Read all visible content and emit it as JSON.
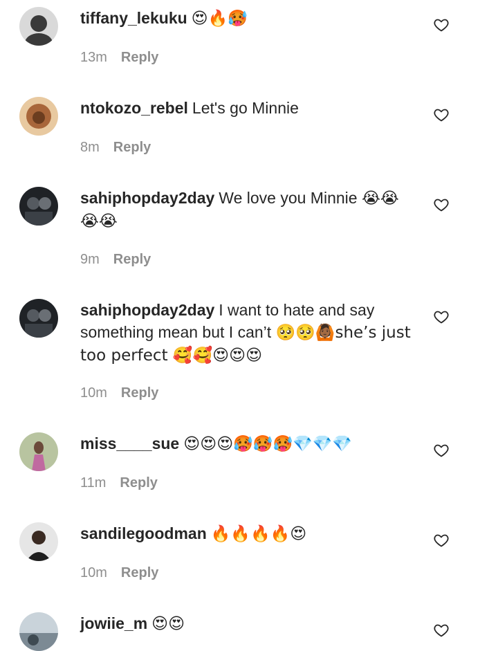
{
  "comments": [
    {
      "username": "tiffany_lekuku",
      "text": "",
      "emoji": "😍🔥🥵",
      "time": "13m",
      "reply": "Reply",
      "avatar_color": "#3a3a3a"
    },
    {
      "username": "ntokozo_rebel",
      "text": "Let's go Minnie",
      "emoji": "",
      "time": "8m",
      "reply": "Reply",
      "avatar_color": "#a8663a"
    },
    {
      "username": "sahiphopday2day",
      "text": "We love you Minnie",
      "emoji": "😭😭 😭😭",
      "time": "9m",
      "reply": "Reply",
      "avatar_color": "#2b2f33"
    },
    {
      "username": "sahiphopday2day",
      "text": "I want to hate and say something mean but I can’t",
      "emoji": "🥺🥺🙆🏾she’s just too perfect 🥰🥰😍😍😍",
      "time": "10m",
      "reply": "Reply",
      "avatar_color": "#2b2f33"
    },
    {
      "username": "miss____sue",
      "text": "",
      "emoji": "😍😍😍🥵🥵🥵💎💎💎",
      "time": "11m",
      "reply": "Reply",
      "avatar_color": "#8a9a6e"
    },
    {
      "username": "sandilegoodman",
      "text": "",
      "emoji": "🔥🔥🔥🔥😍",
      "time": "10m",
      "reply": "Reply",
      "avatar_color": "#1e1e1e"
    },
    {
      "username": "jowiie_m",
      "text": "",
      "emoji": "😍😍",
      "time": "",
      "reply": "",
      "avatar_color": "#7c8a94"
    }
  ]
}
